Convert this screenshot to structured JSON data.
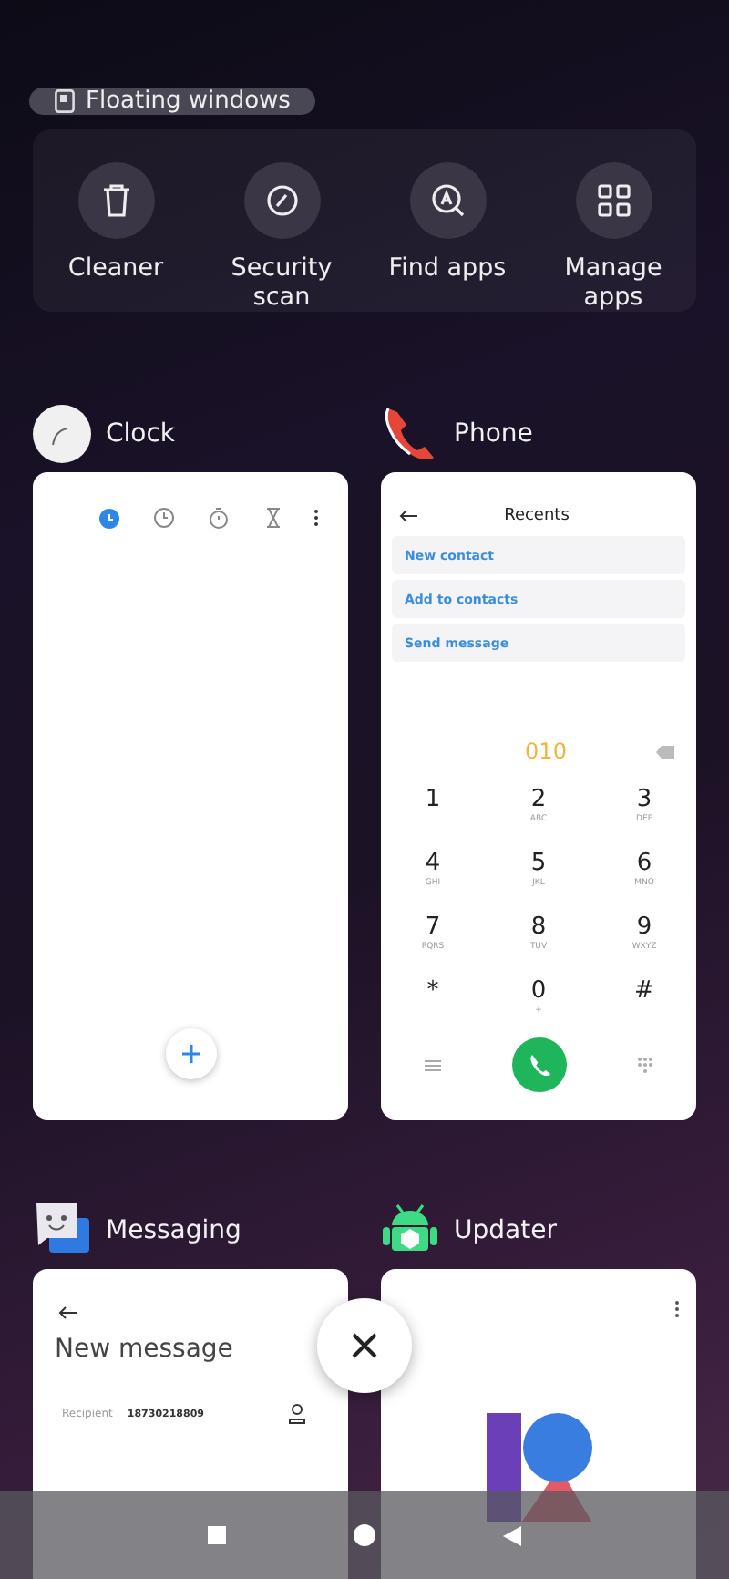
{
  "floating_button": {
    "label": "Floating windows"
  },
  "tools": [
    {
      "kind": "cleaner",
      "label": "Cleaner"
    },
    {
      "kind": "security",
      "label": "Security scan"
    },
    {
      "kind": "find",
      "label": "Find apps"
    },
    {
      "kind": "manage",
      "label": "Manage apps"
    }
  ],
  "clock": {
    "title": "Clock",
    "tabs": [
      {
        "kind": "alarm",
        "selected": true
      },
      {
        "kind": "clock",
        "selected": false
      },
      {
        "kind": "stopwatch",
        "selected": false
      },
      {
        "kind": "timer",
        "selected": false
      }
    ]
  },
  "phone": {
    "title": "Phone",
    "header": "Recents",
    "actions": [
      "New contact",
      "Add to contacts",
      "Send message"
    ],
    "number": "010",
    "keys": [
      {
        "digit": "1"
      },
      {
        "digit": "2",
        "letters": "ABC"
      },
      {
        "digit": "3",
        "letters": "DEF"
      },
      {
        "digit": "4",
        "letters": "GHI"
      },
      {
        "digit": "5",
        "letters": "JKL"
      },
      {
        "digit": "6",
        "letters": "MNO"
      },
      {
        "digit": "7",
        "letters": "PQRS"
      },
      {
        "digit": "8",
        "letters": "TUV"
      },
      {
        "digit": "9",
        "letters": "WXYZ"
      },
      {
        "digit": "*"
      },
      {
        "digit": "0",
        "letters": "+"
      },
      {
        "digit": "#"
      }
    ]
  },
  "messaging": {
    "title": "Messaging",
    "heading": "New message",
    "recipient_label": "Recipient",
    "recipient": "18730218809"
  },
  "updater": {
    "title": "Updater"
  }
}
